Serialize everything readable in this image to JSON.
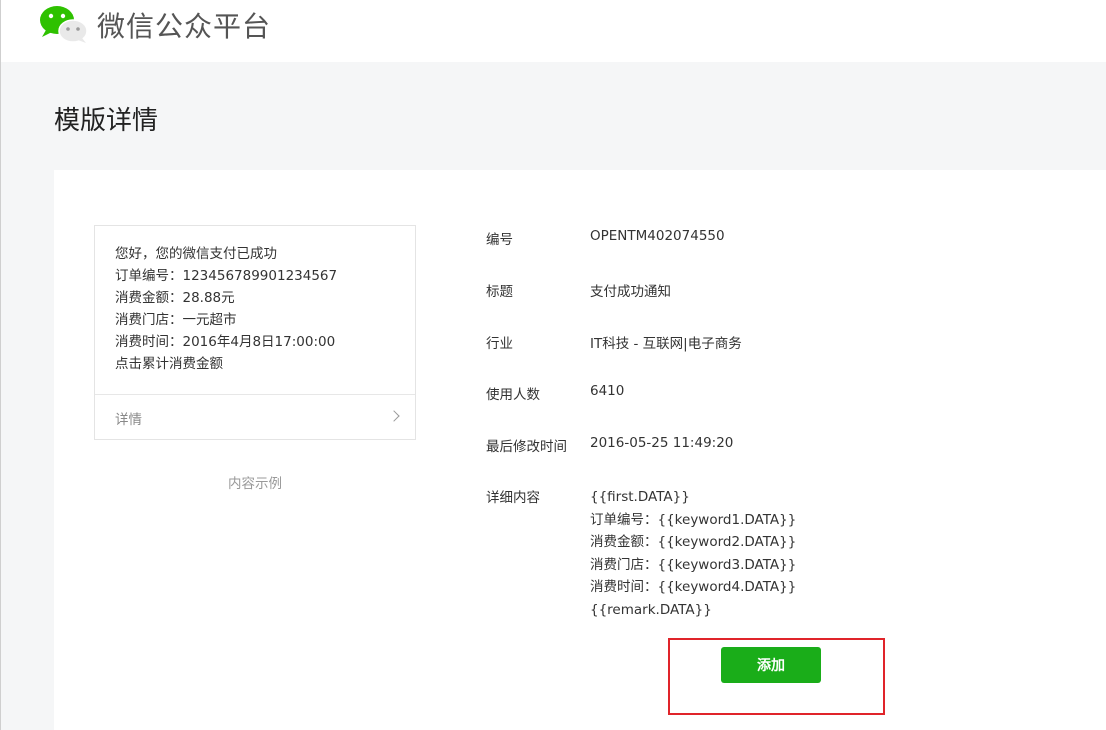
{
  "header": {
    "brand_name": "微信公众平台",
    "logo_icon": "wechat-logo-icon"
  },
  "page": {
    "title": "模版详情"
  },
  "preview": {
    "lines": [
      "您好，您的微信支付已成功",
      "订单编号：123456789901234567",
      "消费金额：28.88元",
      "消费门店：一元超市",
      "消费时间：2016年4月8日17:00:00",
      "点击累计消费金额"
    ],
    "detail_label": "详情",
    "caption": "内容示例"
  },
  "info": {
    "id_label": "编号",
    "id_value": "OPENTM402074550",
    "title_label": "标题",
    "title_value": "支付成功通知",
    "industry_label": "行业",
    "industry_value": "IT科技 - 互联网|电子商务",
    "users_label": "使用人数",
    "users_value": "6410",
    "modified_label": "最后修改时间",
    "modified_value": "2016-05-25 11:49:20",
    "content_label": "详细内容",
    "content_lines": [
      "{{first.DATA}}",
      "订单编号：{{keyword1.DATA}}",
      "消费金额：{{keyword2.DATA}}",
      "消费门店：{{keyword3.DATA}}",
      "消费时间：{{keyword4.DATA}}",
      "{{remark.DATA}}"
    ]
  },
  "actions": {
    "add_label": "添加"
  },
  "colors": {
    "button_green": "#1aad19",
    "highlight_red": "#e0242a",
    "page_bg": "#f5f6f7"
  }
}
